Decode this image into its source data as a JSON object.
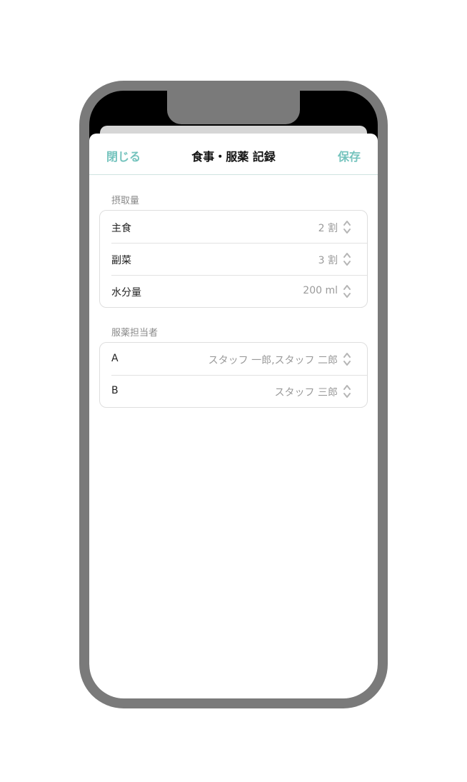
{
  "nav": {
    "close_label": "閉じる",
    "title": "食事・服薬 記録",
    "save_label": "保存"
  },
  "intake": {
    "header": "摂取量",
    "rows": [
      {
        "label": "主食",
        "value": "2 割"
      },
      {
        "label": "副菜",
        "value": "3 割"
      },
      {
        "label": "水分量",
        "value": "200 ml"
      }
    ]
  },
  "medication": {
    "header": "服薬担当者",
    "rows": [
      {
        "label": "A",
        "value": "スタッフ 一郎,スタッフ 二郎"
      },
      {
        "label": "B",
        "value": "スタッフ 三郎"
      }
    ]
  },
  "colors": {
    "accent": "#74c3bd",
    "phone_frame": "#7a7a7a"
  },
  "icons": {
    "row_stepper": "chevron-up-down-icon"
  }
}
